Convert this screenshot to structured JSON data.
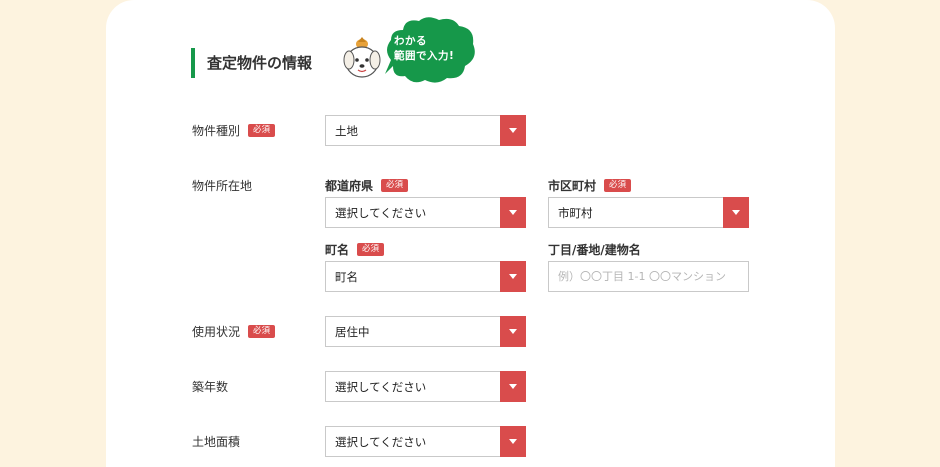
{
  "section": {
    "title": "査定物件の情報",
    "bubble_line1": "わかる",
    "bubble_line2": "範囲で入力!"
  },
  "required_label": "必須",
  "accent_color": "#d94c4c",
  "brand_green": "#16984a",
  "fields": {
    "property_type": {
      "label": "物件種別",
      "value": "土地"
    },
    "location": {
      "label": "物件所在地",
      "prefecture": {
        "label": "都道府県",
        "value": "選択してください"
      },
      "city": {
        "label": "市区町村",
        "value": "市町村"
      },
      "town": {
        "label": "町名",
        "value": "町名"
      },
      "address": {
        "label": "丁目/番地/建物名",
        "placeholder": "例）〇〇丁目 1-1 〇〇マンション"
      }
    },
    "usage": {
      "label": "使用状況",
      "value": "居住中"
    },
    "building_age": {
      "label": "築年数",
      "value": "選択してください"
    },
    "land_area": {
      "label": "土地面積",
      "value": "選択してください"
    }
  }
}
